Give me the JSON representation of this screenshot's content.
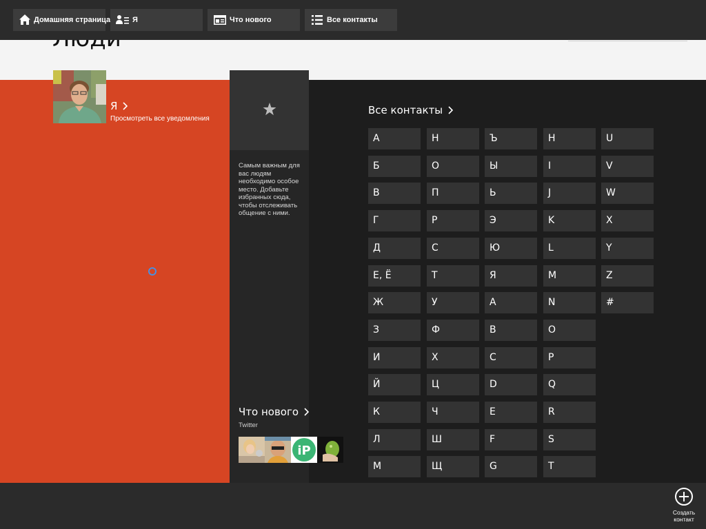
{
  "nav": {
    "home_label": "Домашняя страница",
    "me_label": "Я",
    "whatsnew_label": "Что нового",
    "allcontacts_label": "Все контакты"
  },
  "page": {
    "title": "Люди"
  },
  "me": {
    "name": "Я",
    "subtitle": "Просмотреть все уведомления"
  },
  "favorites": {
    "text": "Самым важным для вас людям необходимо особое место. Добавьте избранных сюда, чтобы отслеживать общение с ними."
  },
  "whatsnew": {
    "title": "Что нового",
    "subtitle": "Twitter"
  },
  "contacts": {
    "title": "Все контакты",
    "columns": [
      [
        "А",
        "Б",
        "В",
        "Г",
        "Д",
        "Е, Ё",
        "Ж",
        "З",
        "И",
        "Й",
        "К",
        "Л",
        "М"
      ],
      [
        "Н",
        "О",
        "П",
        "Р",
        "С",
        "Т",
        "У",
        "Ф",
        "Х",
        "Ц",
        "Ч",
        "Ш",
        "Щ"
      ],
      [
        "Ъ",
        "Ы",
        "Ь",
        "Э",
        "Ю",
        "Я",
        "A",
        "B",
        "C",
        "D",
        "E",
        "F",
        "G"
      ],
      [
        "H",
        "I",
        "J",
        "K",
        "L",
        "M",
        "N",
        "O",
        "P",
        "Q",
        "R",
        "S",
        "T"
      ],
      [
        "U",
        "V",
        "W",
        "X",
        "Y",
        "Z",
        "#"
      ]
    ]
  },
  "appbar": {
    "create_label": "Создать контакт"
  },
  "colors": {
    "accent_orange": "#d64523",
    "tile_dark": "#333333",
    "bar_dark": "#2b2b2b",
    "spinner_blue": "#4a8fe0"
  },
  "icons": [
    "home-icon",
    "me-icon",
    "news-icon",
    "list-icon",
    "star-icon",
    "chevron-right-icon",
    "add-circle-icon"
  ]
}
